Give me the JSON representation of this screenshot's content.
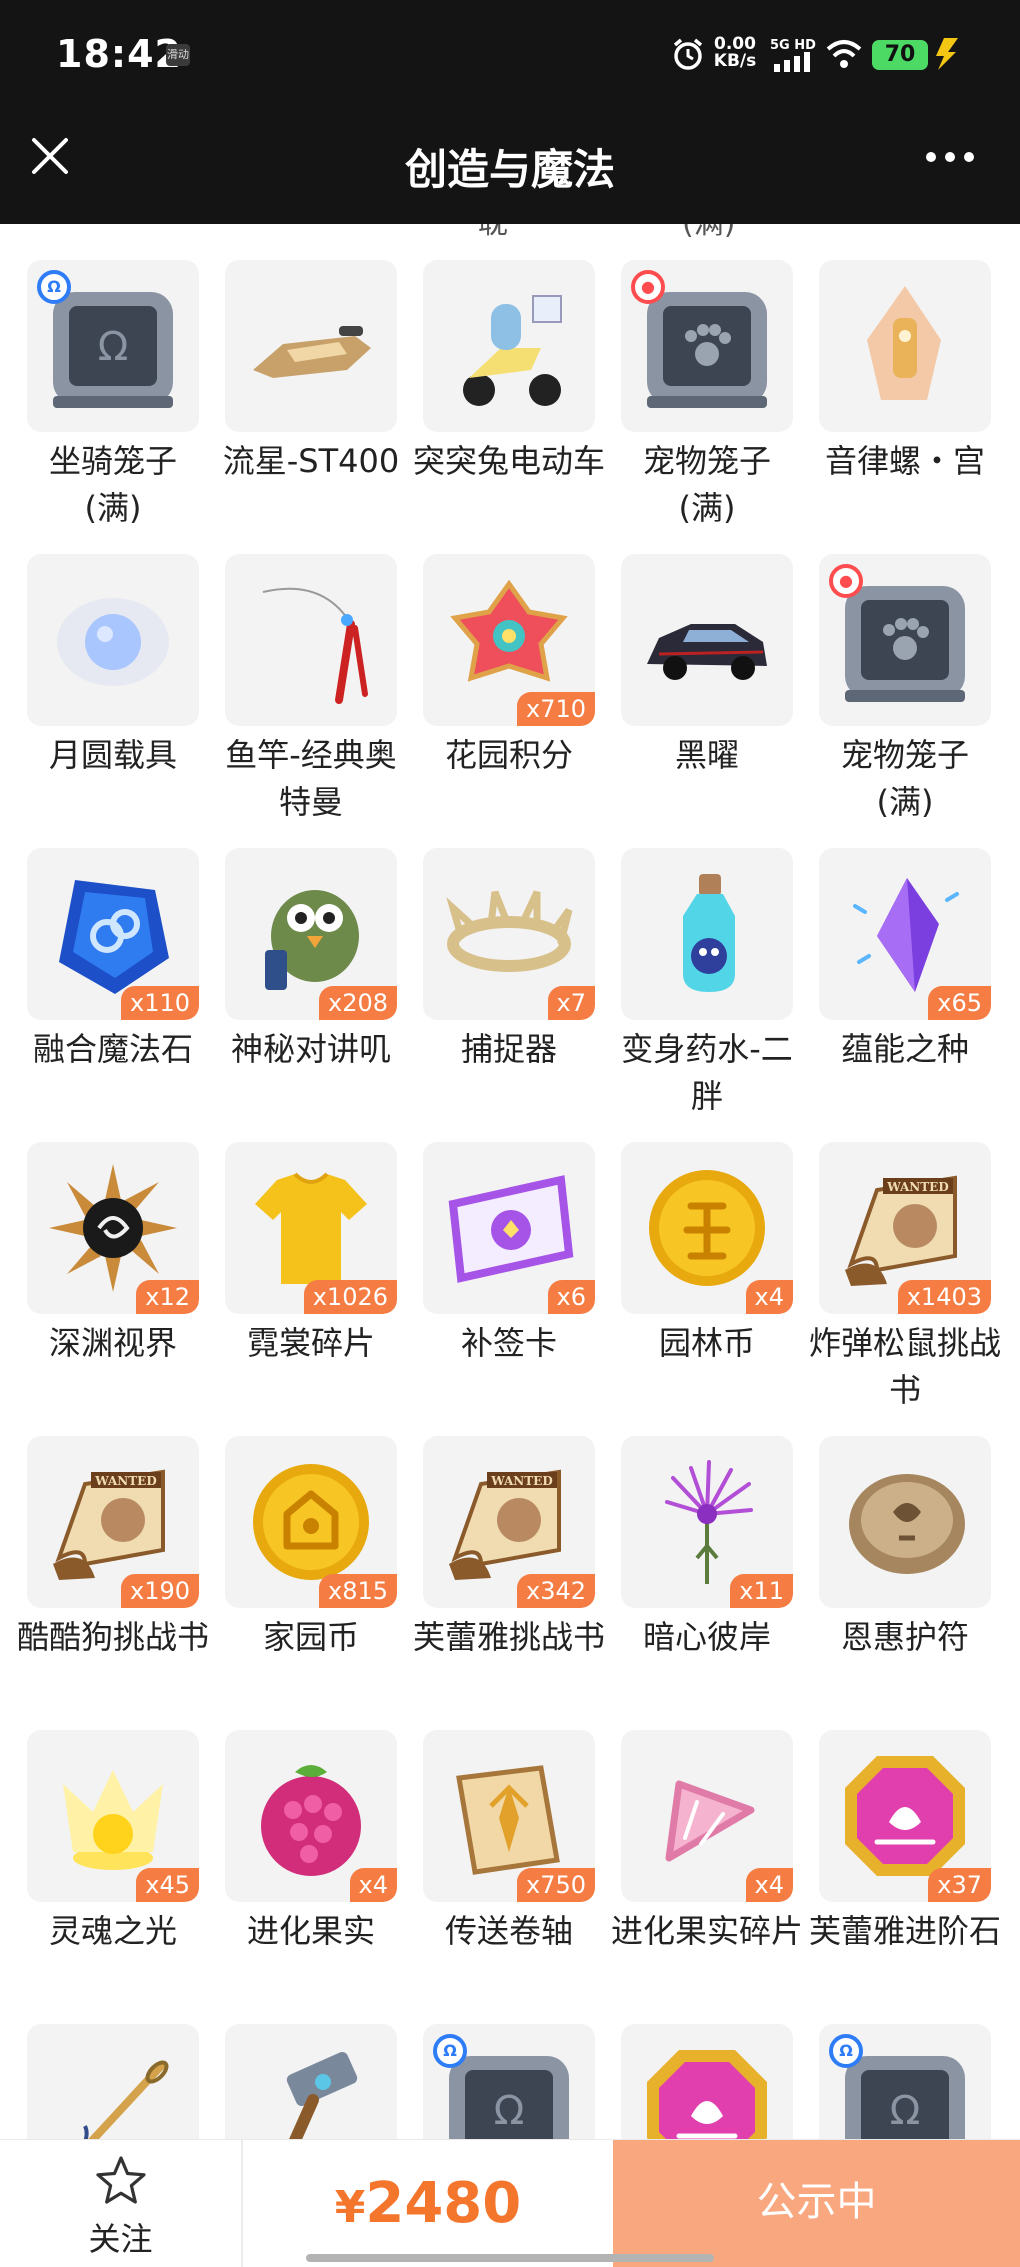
{
  "status_bar": {
    "time": "18:42",
    "chip": "滑动",
    "speed_value": "0.00",
    "speed_unit": "KB/s",
    "network": "5G HD",
    "battery": "70"
  },
  "nav": {
    "title": "创造与魔法"
  },
  "colors": {
    "accent": "#f57d43",
    "price": "#f4762d",
    "status_button": "#f9a77e",
    "header_bg": "#141414"
  },
  "items": [
    {
      "name": "坐骑笼子\n(满)",
      "icon": "mount-cage-icon",
      "badge": "blue"
    },
    {
      "name": "流星-ST400",
      "icon": "hover-bike-icon"
    },
    {
      "name": "突突兔电动车",
      "icon": "scooter-icon"
    },
    {
      "name": "宠物笼子\n(满)",
      "icon": "pet-cage-icon",
      "badge": "red"
    },
    {
      "name": "音律螺・宫",
      "icon": "conch-icon"
    },
    {
      "name": "月圆载具",
      "icon": "moon-vehicle-icon"
    },
    {
      "name": "鱼竿-经典奥特曼",
      "icon": "fishing-rod-icon"
    },
    {
      "name": "花园积分",
      "icon": "flower-token-icon",
      "qty": "x710"
    },
    {
      "name": "黑曜",
      "icon": "car-icon"
    },
    {
      "name": "宠物笼子\n(满)",
      "icon": "pet-cage-icon",
      "badge": "red"
    },
    {
      "name": "融合魔法石",
      "icon": "magic-stone-icon",
      "qty": "x110"
    },
    {
      "name": "神秘对讲叽",
      "icon": "walkie-bird-icon",
      "qty": "x208"
    },
    {
      "name": "捕捉器",
      "icon": "thorn-crown-icon",
      "qty": "x7"
    },
    {
      "name": "变身药水-二胖",
      "icon": "potion-icon"
    },
    {
      "name": "蕴能之种",
      "icon": "crystal-seed-icon",
      "qty": "x65"
    },
    {
      "name": "深渊视界",
      "icon": "abyss-sun-icon",
      "qty": "x12"
    },
    {
      "name": "霓裳碎片",
      "icon": "shirt-icon",
      "qty": "x1026"
    },
    {
      "name": "补签卡",
      "icon": "ticket-icon",
      "qty": "x6"
    },
    {
      "name": "园林币",
      "icon": "garden-coin-icon",
      "qty": "x4"
    },
    {
      "name": "炸弹松鼠挑战书",
      "icon": "wanted-scroll-icon",
      "qty": "x1403"
    },
    {
      "name": "酷酷狗挑战书",
      "icon": "wanted-scroll-icon",
      "qty": "x190"
    },
    {
      "name": "家园币",
      "icon": "home-coin-icon",
      "qty": "x815"
    },
    {
      "name": "芙蕾雅挑战书",
      "icon": "wanted-scroll-icon",
      "qty": "x342"
    },
    {
      "name": "暗心彼岸",
      "icon": "spider-lily-icon",
      "qty": "x11"
    },
    {
      "name": "恩惠护符",
      "icon": "amulet-icon"
    },
    {
      "name": "灵魂之光",
      "icon": "soul-light-icon",
      "qty": "x45"
    },
    {
      "name": "进化果实",
      "icon": "evolution-fruit-icon",
      "qty": "x4"
    },
    {
      "name": "传送卷轴",
      "icon": "teleport-scroll-icon",
      "qty": "x750"
    },
    {
      "name": "进化果实碎片",
      "icon": "fruit-shard-icon",
      "qty": "x4"
    },
    {
      "name": "芙蕾雅进阶石",
      "icon": "advance-gem-icon",
      "qty": "x37"
    },
    {
      "name": "",
      "icon": "needle-icon"
    },
    {
      "name": "",
      "icon": "hammer-icon"
    },
    {
      "name": "",
      "icon": "mount-cage-icon",
      "badge": "blue"
    },
    {
      "name": "",
      "icon": "advance-gem-icon"
    },
    {
      "name": "",
      "icon": "mount-cage-icon",
      "badge": "blue"
    }
  ],
  "bottom_bar": {
    "follow_label": "关注",
    "currency": "¥",
    "price": "2480",
    "status_label": "公示中"
  }
}
